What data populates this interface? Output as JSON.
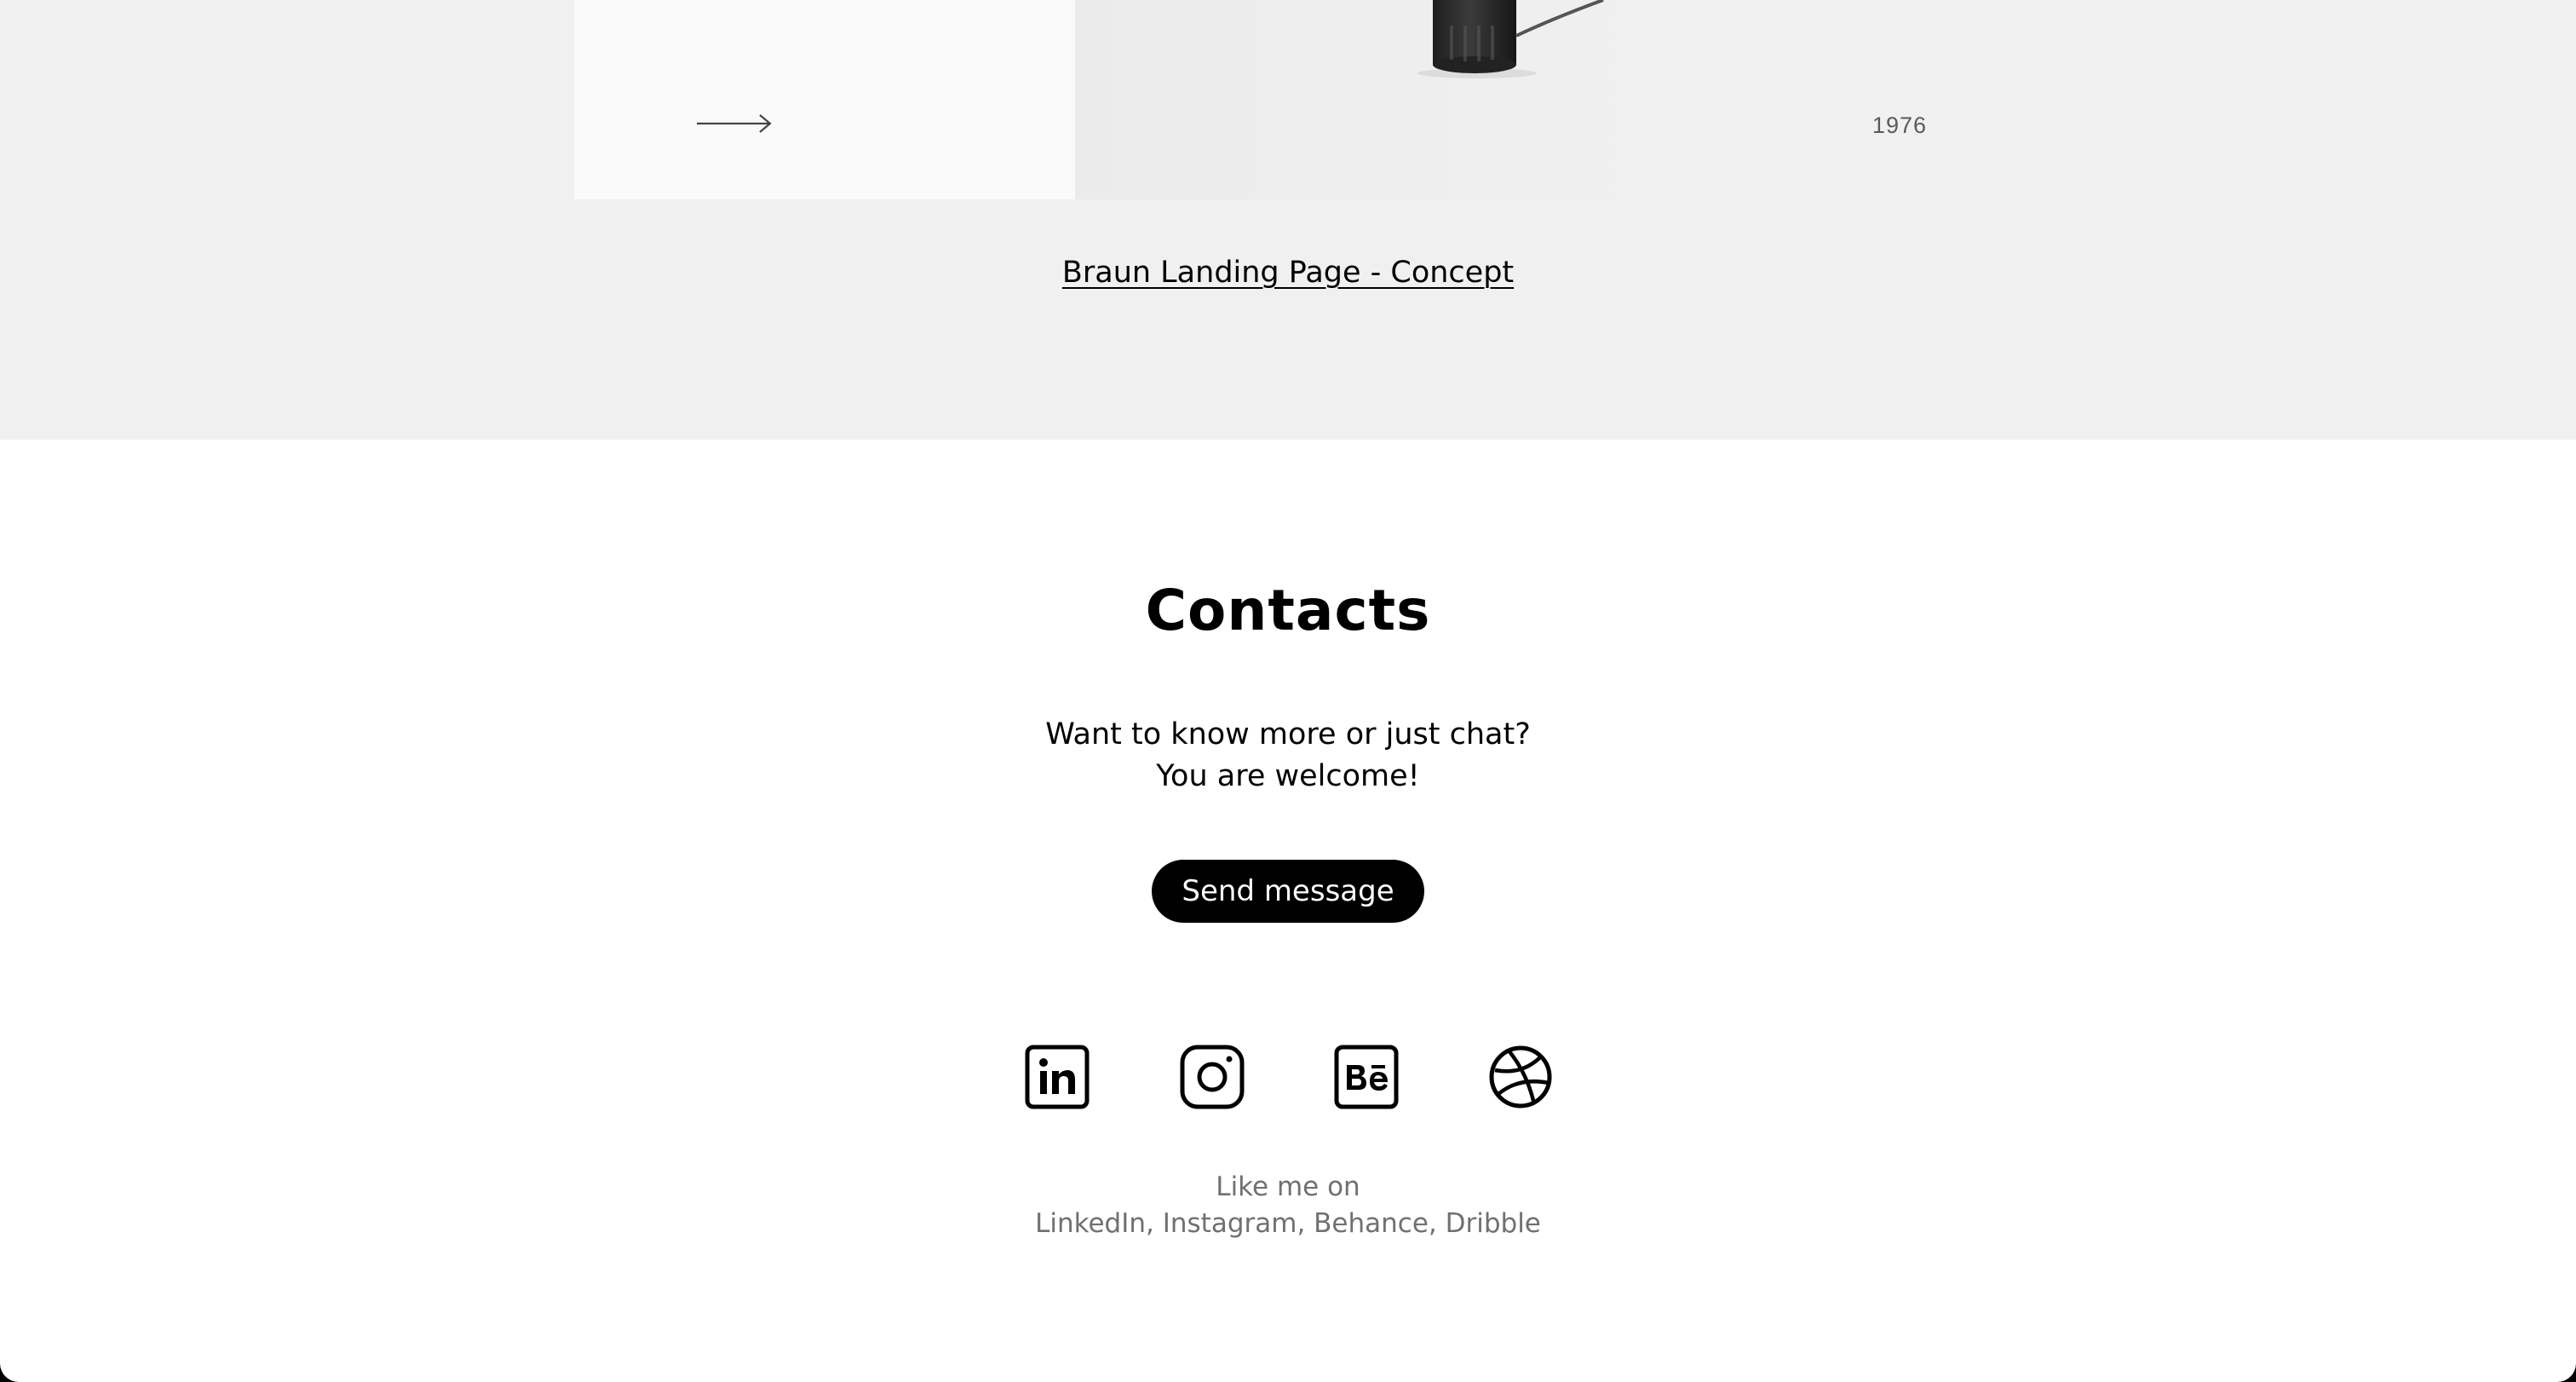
{
  "project": {
    "year": "1976",
    "link_label": "Braun Landing Page - Concept"
  },
  "contacts": {
    "title": "Contacts",
    "text_line1": "Want to know more or just chat?",
    "text_line2": "You are welcome!",
    "send_button_label": "Send message"
  },
  "social": {
    "icons": [
      "linkedin-icon",
      "instagram-icon",
      "behance-icon",
      "dribbble-icon"
    ],
    "caption_line1": "Like me on",
    "caption_line2": "LinkedIn, Instagram, Behance, Dribble"
  },
  "colors": {
    "section_background": "#f0f0f0",
    "page_background": "#ffffff",
    "button_background": "#000000",
    "caption_text": "#707070"
  }
}
